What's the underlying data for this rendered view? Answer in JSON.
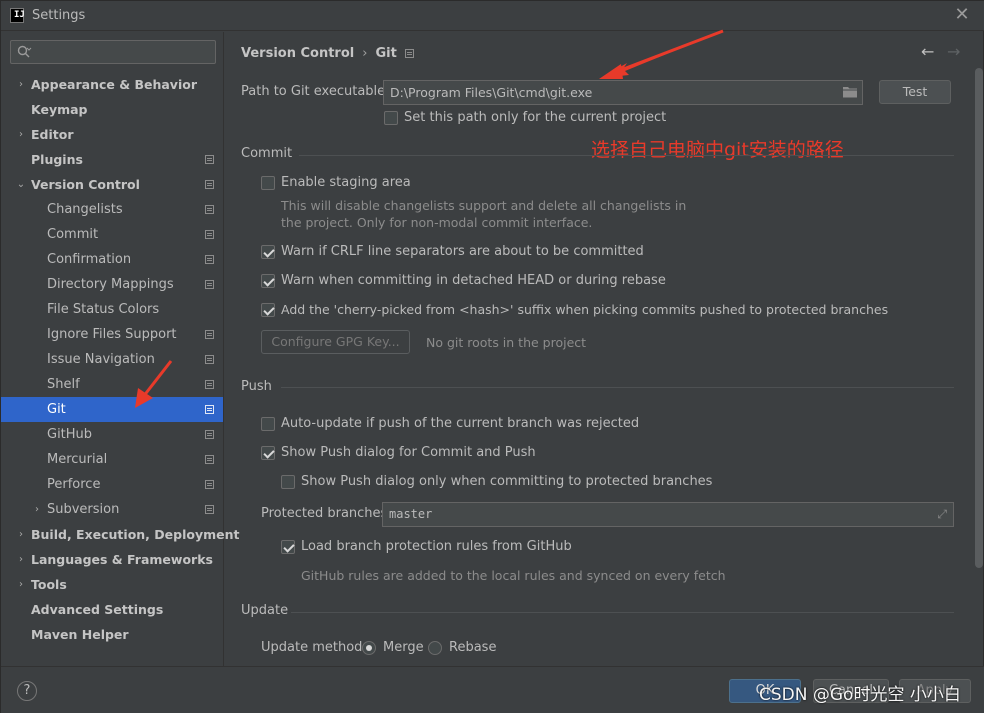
{
  "window": {
    "title": "Settings",
    "app_logo_text": "IJ"
  },
  "search": {
    "placeholder": ""
  },
  "sidebar": {
    "items": [
      {
        "label": "Appearance & Behavior",
        "level": 0,
        "arrow": "›",
        "bold": true,
        "icon": false
      },
      {
        "label": "Keymap",
        "level": 0,
        "arrow": "",
        "bold": true,
        "icon": false
      },
      {
        "label": "Editor",
        "level": 0,
        "arrow": "›",
        "bold": true,
        "icon": false
      },
      {
        "label": "Plugins",
        "level": 0,
        "arrow": "",
        "bold": true,
        "icon": true
      },
      {
        "label": "Version Control",
        "level": 0,
        "arrow": "⌄",
        "bold": true,
        "icon": true
      },
      {
        "label": "Changelists",
        "level": 1,
        "arrow": "",
        "bold": false,
        "icon": true
      },
      {
        "label": "Commit",
        "level": 1,
        "arrow": "",
        "bold": false,
        "icon": true
      },
      {
        "label": "Confirmation",
        "level": 1,
        "arrow": "",
        "bold": false,
        "icon": true
      },
      {
        "label": "Directory Mappings",
        "level": 1,
        "arrow": "",
        "bold": false,
        "icon": true
      },
      {
        "label": "File Status Colors",
        "level": 1,
        "arrow": "",
        "bold": false,
        "icon": false
      },
      {
        "label": "Ignore Files Support",
        "level": 1,
        "arrow": "",
        "bold": false,
        "icon": true
      },
      {
        "label": "Issue Navigation",
        "level": 1,
        "arrow": "",
        "bold": false,
        "icon": true
      },
      {
        "label": "Shelf",
        "level": 1,
        "arrow": "",
        "bold": false,
        "icon": true
      },
      {
        "label": "Git",
        "level": 1,
        "arrow": "",
        "bold": false,
        "icon": true,
        "selected": true
      },
      {
        "label": "GitHub",
        "level": 1,
        "arrow": "",
        "bold": false,
        "icon": true
      },
      {
        "label": "Mercurial",
        "level": 1,
        "arrow": "",
        "bold": false,
        "icon": true
      },
      {
        "label": "Perforce",
        "level": 1,
        "arrow": "",
        "bold": false,
        "icon": true
      },
      {
        "label": "Subversion",
        "level": 1,
        "arrow": "›",
        "bold": false,
        "icon": true
      },
      {
        "label": "Build, Execution, Deployment",
        "level": 0,
        "arrow": "›",
        "bold": true,
        "icon": false
      },
      {
        "label": "Languages & Frameworks",
        "level": 0,
        "arrow": "›",
        "bold": true,
        "icon": false
      },
      {
        "label": "Tools",
        "level": 0,
        "arrow": "›",
        "bold": true,
        "icon": false
      },
      {
        "label": "Advanced Settings",
        "level": 0,
        "arrow": "",
        "bold": true,
        "icon": false
      },
      {
        "label": "Maven Helper",
        "level": 0,
        "arrow": "",
        "bold": true,
        "icon": false
      }
    ]
  },
  "breadcrumb": {
    "parent": "Version Control",
    "separator": "›",
    "current": "Git"
  },
  "git_path": {
    "label": "Path to Git executable:",
    "value": "D:\\Program Files\\Git\\cmd\\git.exe",
    "test_button": "Test",
    "current_project_only": "Set this path only for the current project",
    "current_project_only_checked": false
  },
  "annotation": {
    "text": "选择自己电脑中git安装的路径",
    "color": "#e83a2a"
  },
  "commit": {
    "title": "Commit",
    "staging_area": "Enable staging area",
    "staging_area_checked": false,
    "staging_hint_line1": "This will disable changelists support and delete all changelists in",
    "staging_hint_line2": "the project. Only for non-modal commit interface.",
    "warn_crlf": "Warn if CRLF line separators are about to be committed",
    "warn_crlf_checked": true,
    "warn_detached": "Warn when committing in detached HEAD or during rebase",
    "warn_detached_checked": true,
    "cherry_picked": "Add the 'cherry-picked from <hash>' suffix when picking commits pushed to protected branches",
    "cherry_picked_checked": true,
    "gpg_button": "Configure GPG Key...",
    "gpg_hint": "No git roots in the project"
  },
  "push": {
    "title": "Push",
    "auto_update": "Auto-update if push of the current branch was rejected",
    "auto_update_checked": false,
    "show_push_dialog": "Show Push dialog for Commit and Push",
    "show_push_dialog_checked": true,
    "only_protected": "Show Push dialog only when committing to protected branches",
    "only_protected_checked": false,
    "protected_label": "Protected branches:",
    "protected_value": "master",
    "load_rules": "Load branch protection rules from GitHub",
    "load_rules_checked": true,
    "rules_hint": "GitHub rules are added to the local rules and synced on every fetch"
  },
  "update": {
    "title": "Update",
    "method_label": "Update method:",
    "merge": "Merge",
    "rebase": "Rebase",
    "selected": "Merge"
  },
  "footer": {
    "help": "?",
    "ok": "OK",
    "cancel": "Cancel",
    "apply": "Apply",
    "watermark": "CSDN @Go时光空 小小白"
  }
}
